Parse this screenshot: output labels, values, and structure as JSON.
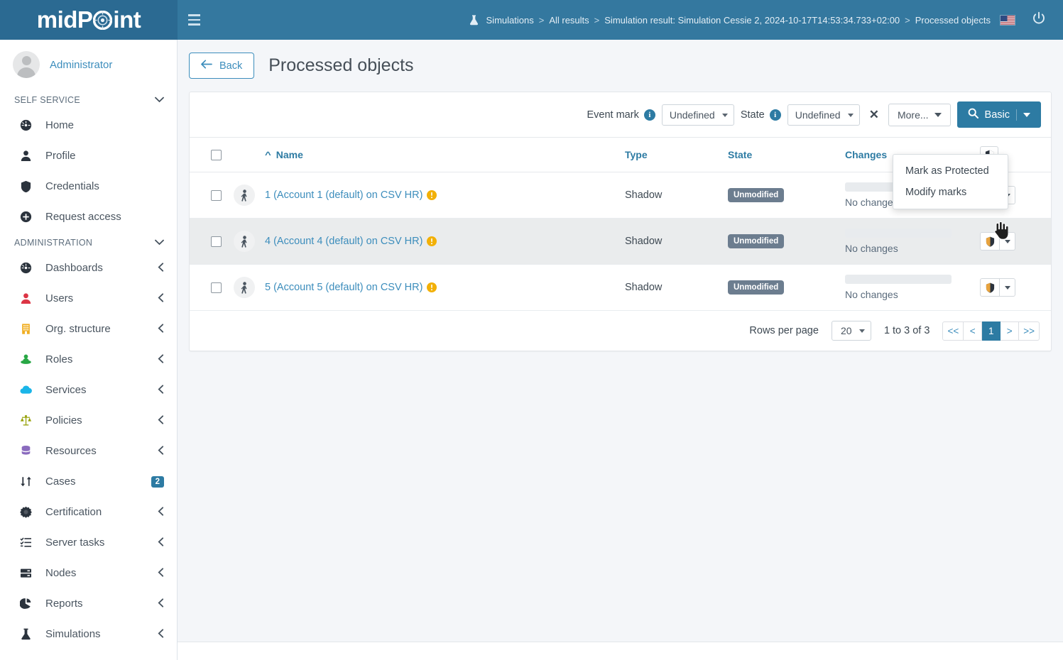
{
  "brand": {
    "text_left": "midP",
    "text_right": "int"
  },
  "topbar": {
    "menu_toggle": "hamburger-menu",
    "breadcrumb": [
      {
        "label": "Simulations",
        "icon": "flask-icon"
      },
      {
        "label": "All results"
      },
      {
        "label": "Simulation result: Simulation Cessie 2, 2024-10-17T14:53:34.733+02:00"
      },
      {
        "label": "Processed objects"
      }
    ],
    "separator": ">",
    "locale": "en-US-flag",
    "logout": "power-icon"
  },
  "sidebar": {
    "user": "Administrator",
    "sections": [
      {
        "title": "SELF SERVICE",
        "items": [
          {
            "label": "Home",
            "icon": "dashboard-icon",
            "color": "#2b333d",
            "arrow": ""
          },
          {
            "label": "Profile",
            "icon": "user-icon",
            "color": "#2b333d",
            "arrow": ""
          },
          {
            "label": "Credentials",
            "icon": "shield-icon",
            "color": "#2b333d",
            "arrow": ""
          },
          {
            "label": "Request access",
            "icon": "plus-circle-icon",
            "color": "#2b333d",
            "arrow": ""
          }
        ]
      },
      {
        "title": "ADMINISTRATION",
        "items": [
          {
            "label": "Dashboards",
            "icon": "dashboard-icon",
            "color": "#2b333d",
            "arrow": "‹"
          },
          {
            "label": "Users",
            "icon": "user-icon",
            "color": "#dc3545",
            "arrow": "‹"
          },
          {
            "label": "Org. structure",
            "icon": "building-icon",
            "color": "#f0ad20",
            "arrow": "‹"
          },
          {
            "label": "Roles",
            "icon": "role-icon",
            "color": "#28a745",
            "arrow": "‹"
          },
          {
            "label": "Services",
            "icon": "cloud-icon",
            "color": "#1ab5e8",
            "arrow": "‹"
          },
          {
            "label": "Policies",
            "icon": "scale-icon",
            "color": "#96a108",
            "arrow": "‹"
          },
          {
            "label": "Resources",
            "icon": "database-icon",
            "color": "#8a6bbe",
            "arrow": "‹"
          },
          {
            "label": "Cases",
            "icon": "cases-icon",
            "color": "#2b333d",
            "arrow": "",
            "badge": "2"
          },
          {
            "label": "Certification",
            "icon": "certificate-icon",
            "color": "#2b333d",
            "arrow": "‹"
          },
          {
            "label": "Server tasks",
            "icon": "tasks-icon",
            "color": "#2b333d",
            "arrow": "‹"
          },
          {
            "label": "Nodes",
            "icon": "server-icon",
            "color": "#2b333d",
            "arrow": "‹"
          },
          {
            "label": "Reports",
            "icon": "pie-chart-icon",
            "color": "#2b333d",
            "arrow": "‹"
          },
          {
            "label": "Simulations",
            "icon": "flask-icon",
            "color": "#2b333d",
            "arrow": "‹"
          }
        ]
      }
    ]
  },
  "page": {
    "back_label": "Back",
    "title": "Processed objects"
  },
  "filters": {
    "event_mark_label": "Event mark",
    "event_mark_value": "Undefined",
    "state_label": "State",
    "state_value": "Undefined",
    "clear_icon": "✕",
    "more_label": "More...",
    "search_label": "Basic",
    "select_options": [
      "Undefined"
    ]
  },
  "table": {
    "columns": [
      "Name",
      "Type",
      "State",
      "Changes"
    ],
    "sort_column": "Name",
    "sort_direction": "asc",
    "rows": [
      {
        "name": "1 (Account 1 (default) on CSV HR)",
        "type": "Shadow",
        "state": "Unmodified",
        "changes": "No changes",
        "warning": true
      },
      {
        "name": "4 (Account 4 (default) on CSV HR)",
        "type": "Shadow",
        "state": "Unmodified",
        "changes": "No changes",
        "warning": true
      },
      {
        "name": "5 (Account 5 (default) on CSV HR)",
        "type": "Shadow",
        "state": "Unmodified",
        "changes": "No changes",
        "warning": true
      }
    ]
  },
  "dropdown": {
    "open_for_row": 2,
    "items": [
      {
        "label": "Mark as Protected"
      },
      {
        "label": "Modify marks"
      }
    ]
  },
  "pagination": {
    "rows_per_page_label": "Rows per page",
    "rows_per_page_value": "20",
    "rows_per_page_options": [
      "20"
    ],
    "range_label": "1 to 3 of 3",
    "buttons": [
      "<<",
      "<",
      "1",
      ">",
      ">>"
    ],
    "active_button": "1"
  },
  "colors": {
    "header_blue": "#34789f",
    "brand_blue": "#2b6a92",
    "accent": "#2d7ba3",
    "link": "#3c8dbc",
    "badge_state": "#6c7d8f",
    "warning": "#f2b007"
  }
}
